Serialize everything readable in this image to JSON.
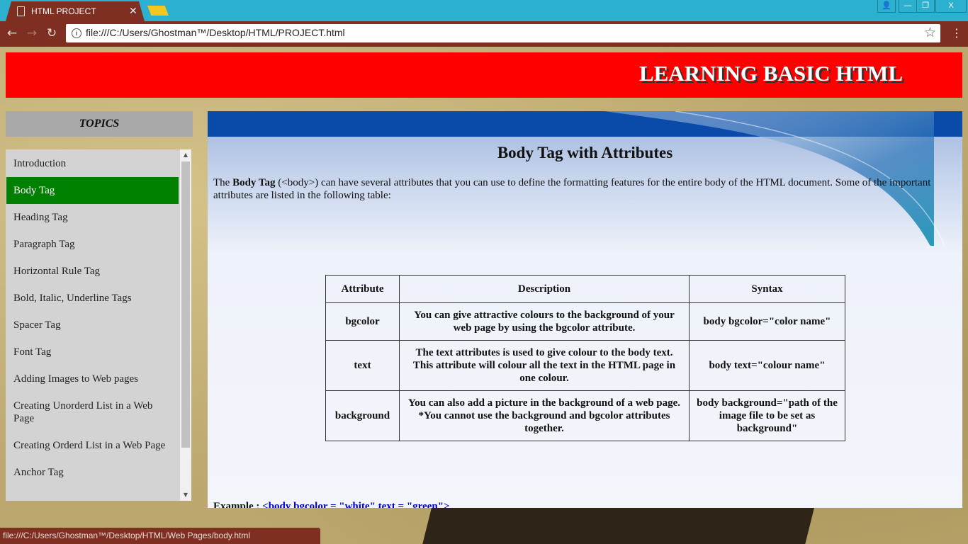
{
  "browser": {
    "tab_title": "HTML PROJECT",
    "tab_close": "✕",
    "url": "file:///C:/Users/Ghostman™/Desktop/HTML/PROJECT.html",
    "window_controls": {
      "user": "👤",
      "min": "—",
      "max": "❐",
      "close": "X"
    },
    "status_url": "file:///C:/Users/Ghostman™/Desktop/HTML/Web Pages/body.html"
  },
  "banner": {
    "title": "LEARNING BASIC HTML"
  },
  "sidebar": {
    "header": "TOPICS",
    "items": [
      {
        "label": "Introduction"
      },
      {
        "label": "Body Tag"
      },
      {
        "label": "Heading Tag"
      },
      {
        "label": "Paragraph Tag"
      },
      {
        "label": "Horizontal Rule Tag"
      },
      {
        "label": "Bold, Italic, Underline Tags"
      },
      {
        "label": "Spacer Tag"
      },
      {
        "label": "Font Tag"
      },
      {
        "label": "Adding Images to Web pages"
      },
      {
        "label": "Creating Unorderd List in a Web Page"
      },
      {
        "label": "Creating Orderd List in a Web Page"
      },
      {
        "label": "Anchor Tag"
      }
    ],
    "active_index": 1
  },
  "main": {
    "heading": "Body Tag with Attributes",
    "intro_prefix": "The ",
    "intro_bold": "Body Tag",
    "intro_rest": " (<body>) can have several attributes that you can use to define the formatting features for the entire body of the HTML document. Some of the important attributes are listed in the following table:",
    "table": {
      "headers": [
        "Attribute",
        "Description",
        "Syntax"
      ],
      "rows": [
        {
          "attribute": "bgcolor",
          "description": "You can give attractive colours to the background of your web page by using the bgcolor attribute.",
          "description2": "",
          "syntax": "body bgcolor=\"color name\""
        },
        {
          "attribute": "text",
          "description": "The text attributes is used to give colour to the body text. This attribute will colour all the text in the HTML page in one colour.",
          "description2": "",
          "syntax": "body text=\"colour name\""
        },
        {
          "attribute": "background",
          "description": "You can also add a picture in the background of a web page.",
          "description2": "*You cannot use the background and bgcolor attributes together.",
          "syntax": "body background=\"path of the image file to be set as background\""
        }
      ]
    },
    "example_label": "Example : ",
    "example_link": "<body bgcolor = \"white\" text = \"green\">"
  },
  "colors": {
    "banner": "#ff0000",
    "active_topic": "#008000",
    "browser_frame": "#7e2f22",
    "title_bar": "#2bb0cf",
    "content_bar": "#0a4aa8"
  }
}
